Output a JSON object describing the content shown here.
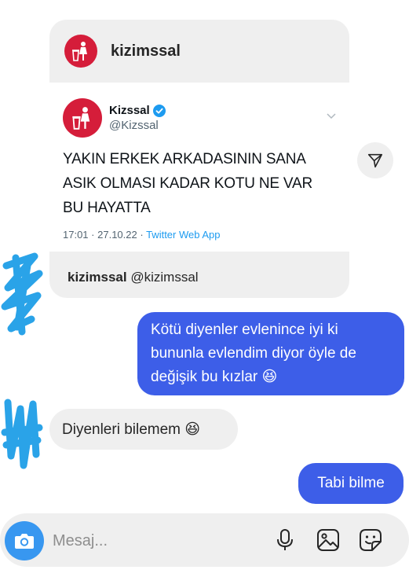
{
  "shared_post": {
    "sender_username": "kizimssal",
    "tweet": {
      "display_name": "Kizssal",
      "handle": "@Kizssal",
      "text_lines": [
        "YAKIN ERKEK ARKADASININ SANA",
        "ASIK OLMASI KADAR KOTU NE VAR",
        "BU HAYATTA"
      ],
      "time": "17:01",
      "date": "27.10.22",
      "source": "Twitter Web App"
    },
    "footer_username": "kizimssal",
    "footer_handle": "@kizimssal"
  },
  "messages": [
    {
      "from": "me",
      "lines": [
        "Kötü diyenler evlenince iyi ki",
        "bununla evlendim diyor öyle de",
        "değişik bu kızlar 😆"
      ]
    },
    {
      "from": "them",
      "text": "Diyenleri bilemem 😆"
    },
    {
      "from": "me",
      "text": "Tabi bilme"
    }
  ],
  "composer": {
    "placeholder": "Mesaj..."
  },
  "icons": {
    "share": "paper-plane-icon",
    "camera": "camera-icon",
    "mic": "microphone-icon",
    "gallery": "image-icon",
    "sticker": "sticker-icon",
    "verified": "verified-badge-icon",
    "caret": "chevron-down-icon"
  },
  "colors": {
    "outgoing_bubble": "#3d5ee8",
    "incoming_bubble": "#efefef",
    "avatar_brand": "#d51d3a",
    "twitter_blue": "#1d9bf0",
    "camera_button": "#3897f0",
    "scribble": "#2aa3e8"
  }
}
